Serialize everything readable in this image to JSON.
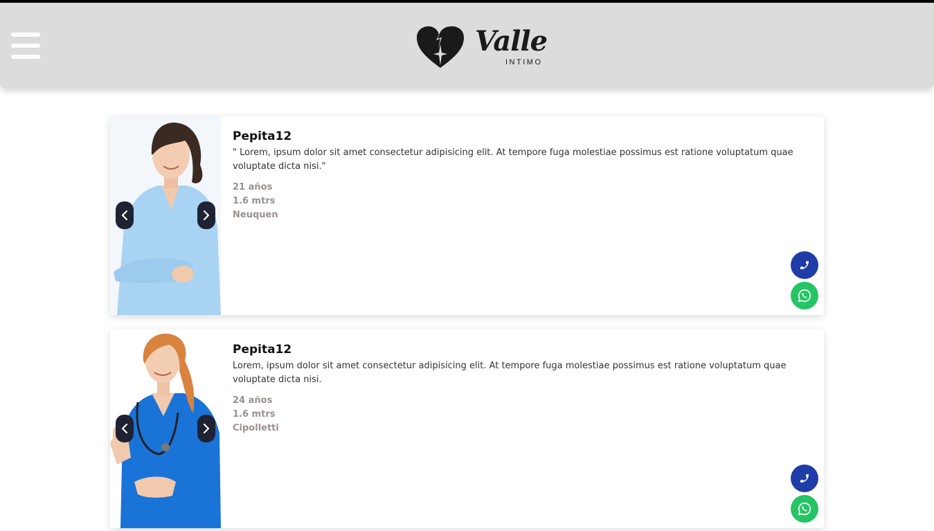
{
  "header": {
    "logo_word": "Valle",
    "logo_sub": "INTIMO"
  },
  "colors": {
    "header_bg": "#dcdcdc",
    "phone_button": "#1f3da8",
    "whatsapp_button": "#25c464",
    "carousel_button": "#1e2233",
    "meta_text": "#9a9090"
  },
  "profiles": [
    {
      "name": "Pepita12",
      "description": "\" Lorem, ipsum dolor sit amet consectetur adipisicing elit. At tempore fuga molestiae possimus est ratione voluptatum quae voluptate dicta nisi.\"",
      "age": "21 años",
      "height": "1.6 mtrs",
      "city": "Neuquen"
    },
    {
      "name": "Pepita12",
      "description": "Lorem, ipsum dolor sit amet consectetur adipisicing elit. At tempore fuga molestiae possimus est ratione voluptatum quae voluptate dicta nisi.",
      "age": "24 años",
      "height": "1.6 mtrs",
      "city": "Cipolletti"
    }
  ],
  "icons": [
    "menu-icon",
    "heart-logo-icon",
    "chevron-left-icon",
    "chevron-right-icon",
    "phone-icon",
    "whatsapp-icon"
  ]
}
